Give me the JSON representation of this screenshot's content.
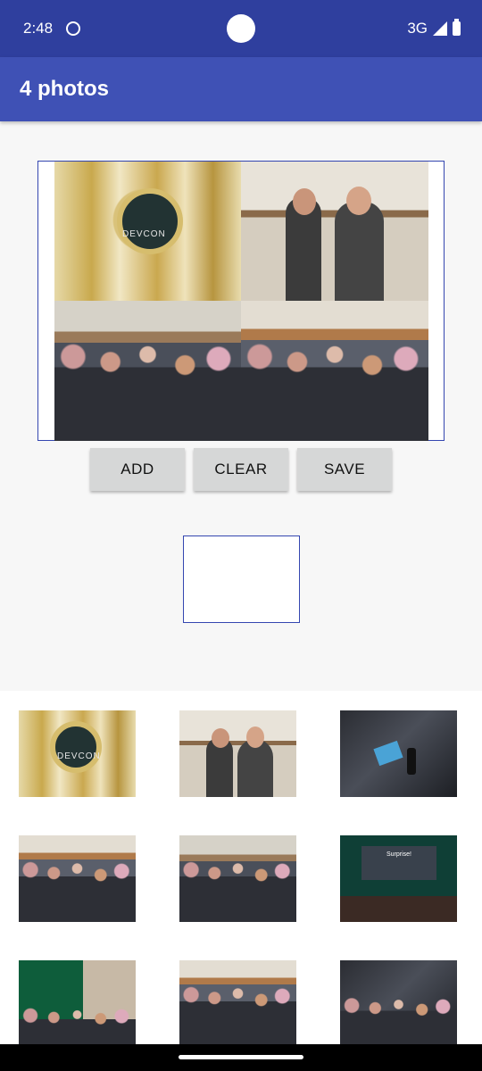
{
  "status_bar": {
    "time": "2:48",
    "network": "3G",
    "icons": [
      "cat-icon",
      "signal-icon",
      "battery-icon"
    ]
  },
  "app_bar": {
    "title": "4 photos"
  },
  "collage": {
    "photos": [
      {
        "name": "devcon-trophy",
        "logo_text": "DEVCON"
      },
      {
        "name": "two-people-posing"
      },
      {
        "name": "crowd-at-tables"
      },
      {
        "name": "audience-seated"
      }
    ]
  },
  "buttons": {
    "add": "ADD",
    "clear": "CLEAR",
    "save": "SAVE"
  },
  "colors": {
    "status_bar": "#2f3f9e",
    "app_bar": "#3f51b5",
    "border_accent": "#3446b0",
    "button_bg": "#d6d7d7"
  },
  "gallery": {
    "thumbnails": [
      {
        "name": "devcon-trophy",
        "logo_text": "DEVCON"
      },
      {
        "name": "two-people-posing"
      },
      {
        "name": "speaker-with-mic"
      },
      {
        "name": "audience-seated"
      },
      {
        "name": "crowd-at-tables"
      },
      {
        "name": "stage-presentation",
        "screen_text": "Surprise!"
      },
      {
        "name": "green-stage-audience"
      },
      {
        "name": "audience-lanyards"
      },
      {
        "name": "people-at-dinner"
      }
    ]
  }
}
